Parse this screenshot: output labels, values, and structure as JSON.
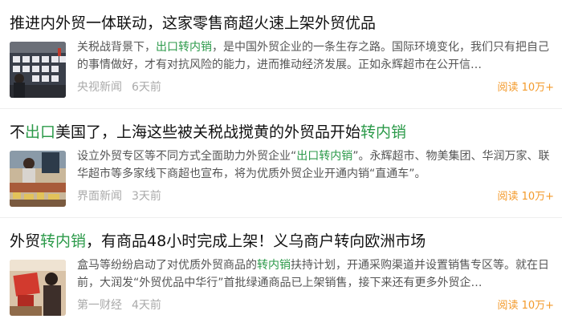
{
  "articles": [
    {
      "title": [
        "推进内外贸一体联动，这家零售商超火速上架外贸优品"
      ],
      "snippet_parts": [
        "关税战背景下，",
        "出口转内销",
        "，是中国外贸企业的一条生存之路。国际环境变化，我们只有把自己的事情做好，才有对抗风险的能力，进而推动经济发展。正如永辉超市在公开信…"
      ],
      "source": "央视新闻",
      "time": "6天前",
      "reads_label": "阅读",
      "reads_value": "10万+",
      "thumb_icon": "store-shelves-photo"
    },
    {
      "title": [
        "不",
        "出口",
        "美国了，上海这些被关税战搅黄的外贸品开始",
        "转内销"
      ],
      "snippet_parts": [
        "设立外贸专区等不同方式全面助力外贸企业“",
        "出口转内销",
        "”。永辉超市、物美集团、华润万家、联华超市等多家线下商超也宣布，将为优质外贸企业开通内销“直通车”。"
      ],
      "source": "界面新闻",
      "time": "3天前",
      "reads_label": "阅读",
      "reads_value": "10万+",
      "thumb_icon": "market-stall-photo"
    },
    {
      "title": [
        "外贸",
        "转内销",
        "，有商品48小时完成上架！义乌商户转向欧洲市场"
      ],
      "snippet_parts": [
        "盒马等纷纷启动了对优质外贸商品的",
        "转内销",
        "扶持计划，开通采购渠道并设置销售专区等。就在日前，大润发“外贸优品中华行”首批绿通商品已上架销售，接下来还有更多外贸企…"
      ],
      "source": "第一财经",
      "time": "4天前",
      "reads_label": "阅读",
      "reads_value": "10万+",
      "thumb_icon": "shop-owner-photo"
    }
  ],
  "highlight_color": "#2c9a4a",
  "reads_color": "#f39a2b"
}
